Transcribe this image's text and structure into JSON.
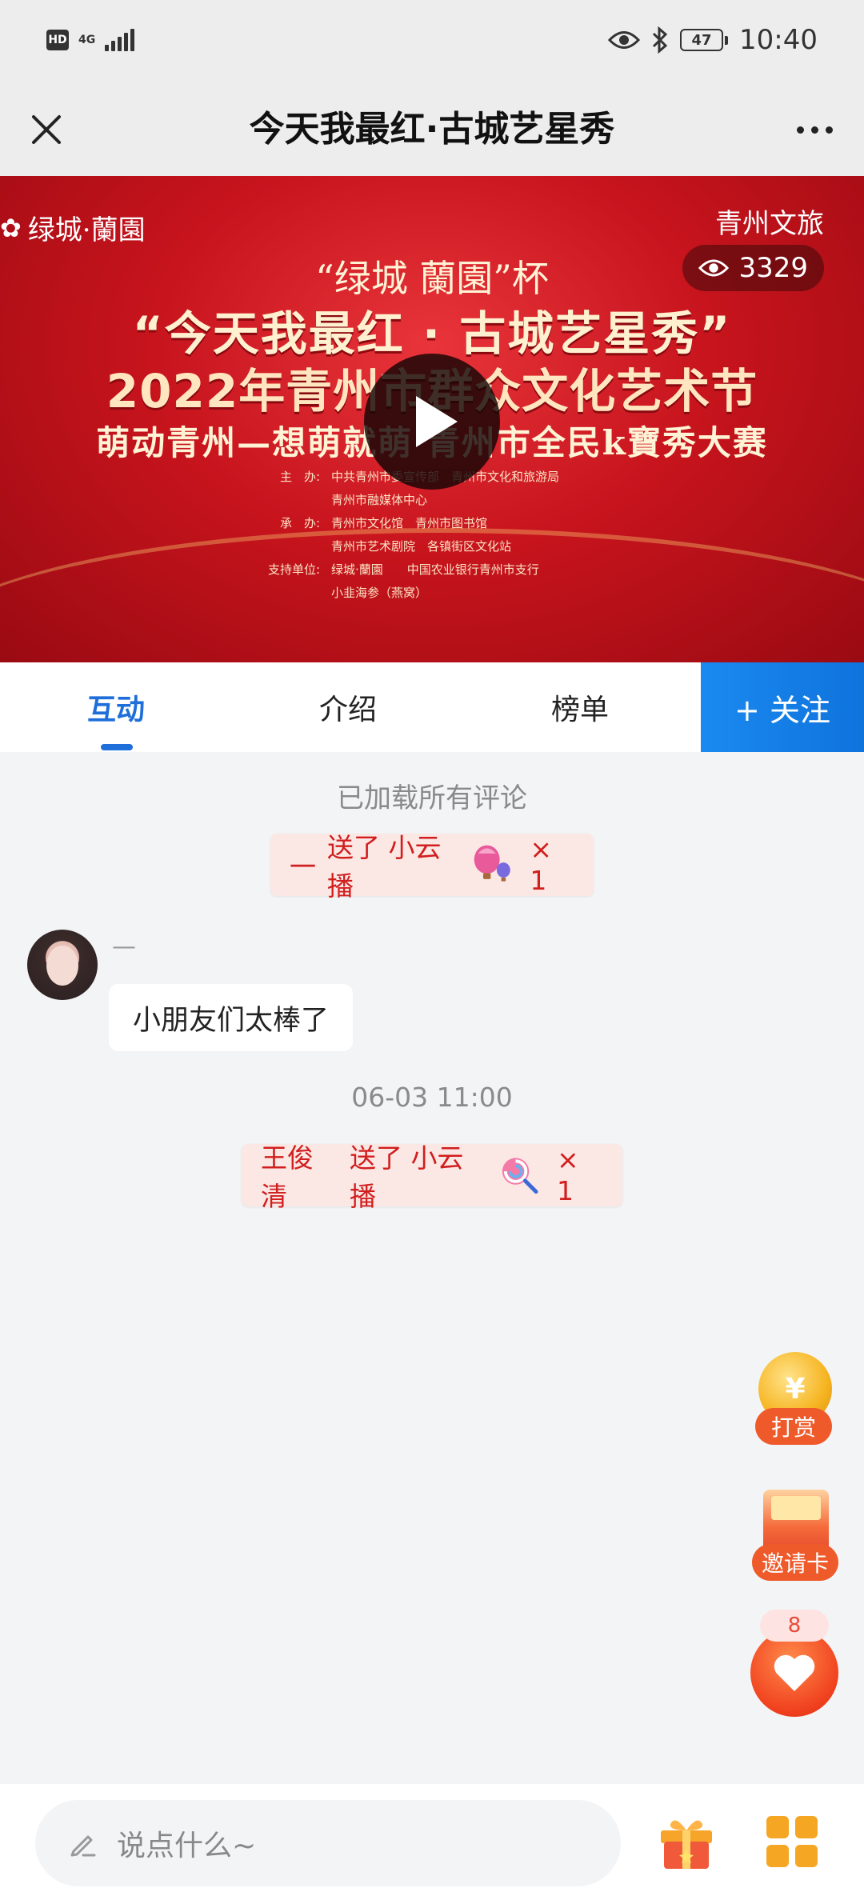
{
  "status_bar": {
    "hd": "HD",
    "network": "4G",
    "battery": "47",
    "time": "10:40"
  },
  "header": {
    "title": "今天我最红·古城艺星秀"
  },
  "video": {
    "publisher": "青州文旅",
    "views": "3329",
    "brand": "绿城·蘭園",
    "poster": {
      "line1": "“绿城 蘭園”杯",
      "line2": "“今天我最红 · 古城艺星秀”",
      "line3": "2022年青州市群众文化艺术节",
      "line4": "萌动青州—想萌就萌 青州市全民k寶秀大赛",
      "credits": [
        {
          "label": "主　办:",
          "text": "中共青州市委宣传部　青州市文化和旅游局"
        },
        {
          "label": "",
          "text": "青州市融媒体中心"
        },
        {
          "label": "承　办:",
          "text": "青州市文化馆　青州市图书馆"
        },
        {
          "label": "",
          "text": "青州市艺术剧院　各镇街区文化站"
        },
        {
          "label": "支持单位:",
          "text": "绿城·蘭園　　中国农业银行青州市支行"
        },
        {
          "label": "",
          "text": "小韭海参（燕窝）"
        }
      ]
    }
  },
  "tabs": [
    {
      "label": "互动",
      "active": true
    },
    {
      "label": "介绍",
      "active": false
    },
    {
      "label": "榜单",
      "active": false
    }
  ],
  "follow_label": "+ 关注",
  "feed": {
    "loaded_note": "已加载所有评论",
    "gift1": {
      "sender": "一",
      "action": "送了 小云播",
      "count": "× 1"
    },
    "comment": {
      "name": "—",
      "text": "小朋友们太棒了"
    },
    "timestamp": "06-03 11:00",
    "gift2": {
      "sender": "王俊清",
      "action": "送了 小云播",
      "count": "× 1"
    }
  },
  "floating": {
    "reward_label": "打赏",
    "invite_label": "邀请卡",
    "like_count": "8"
  },
  "bottom_bar": {
    "input_placeholder": "说点什么~"
  },
  "colors": {
    "accent_blue": "#1e6fd9",
    "gift_red": "#d11e1e",
    "orange": "#ef5a2a"
  }
}
